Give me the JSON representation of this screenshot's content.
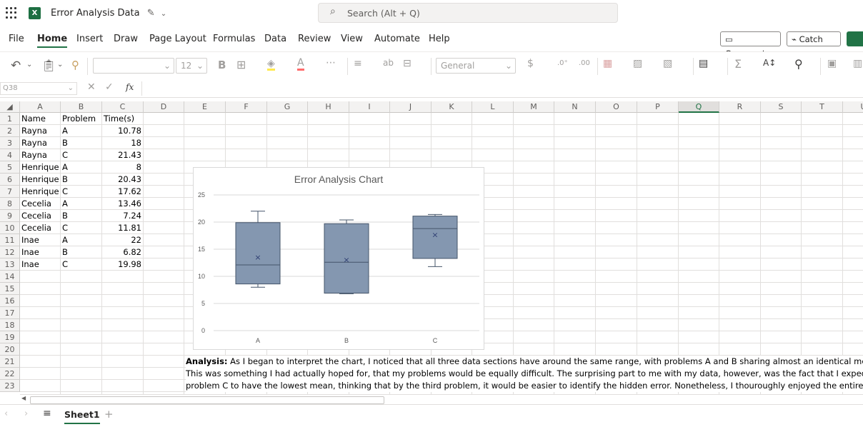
{
  "titlebar": {
    "doc_title": "Error Analysis Data",
    "app_icon_letter": "X",
    "search_placeholder": "Search (Alt + Q)"
  },
  "menu": {
    "items": [
      "File",
      "Home",
      "Insert",
      "Draw",
      "Page Layout",
      "Formulas",
      "Data",
      "Review",
      "View",
      "Automate",
      "Help"
    ],
    "active": "Home",
    "comments_label": "Comments",
    "catchup_label": "Catch up"
  },
  "ribbon": {
    "font_size": "12",
    "number_format": "General"
  },
  "formula_bar": {
    "name_box": "Q38",
    "fx_label": "fx"
  },
  "sheet": {
    "columns": [
      "A",
      "B",
      "C",
      "D",
      "E",
      "F",
      "G",
      "H",
      "I",
      "J",
      "K",
      "L",
      "M",
      "N",
      "O",
      "P",
      "Q",
      "R",
      "S",
      "T",
      "U"
    ],
    "selected_column": "Q",
    "row_numbers": [
      "1",
      "2",
      "3",
      "4",
      "5",
      "6",
      "7",
      "8",
      "9",
      "10",
      "11",
      "12",
      "13",
      "14",
      "15",
      "16",
      "17",
      "18",
      "19",
      "20",
      "21",
      "22",
      "23"
    ],
    "headers": [
      "Name",
      "Problem",
      "Time(s)"
    ],
    "rows": [
      [
        "Rayna",
        "A",
        "10.78"
      ],
      [
        "Rayna",
        "B",
        "18"
      ],
      [
        "Rayna",
        "C",
        "21.43"
      ],
      [
        "Henrique",
        "A",
        "8"
      ],
      [
        "Henrique",
        "B",
        "20.43"
      ],
      [
        "Henrique",
        "C",
        "17.62"
      ],
      [
        "Cecelia",
        "A",
        "13.46"
      ],
      [
        "Cecelia",
        "B",
        "7.24"
      ],
      [
        "Cecelia",
        "C",
        "11.81"
      ],
      [
        "Inae",
        "A",
        "22"
      ],
      [
        "Inae",
        "B",
        "6.82"
      ],
      [
        "Inae",
        "C",
        "19.98"
      ]
    ],
    "analysis_label": "Analysis:",
    "analysis_lines": [
      " As I began to interpret the chart, I noticed that all three data sections have around the same range, with problems A and B sharing almost an identical mean.",
      "This was something I had actually hoped for, that my problems would be equally difficult. The surprising part to me with my data, however, was the fact that I expected",
      "problem C to have the lowest mean, thinking that by the third problem, it would be easier to identify the hidden error. Nonetheless, I thouroughly enjoyed the entire process,"
    ]
  },
  "chart_data": {
    "type": "box",
    "title": "Error Analysis Chart",
    "categories": [
      "A",
      "B",
      "C"
    ],
    "ylim": [
      0,
      25
    ],
    "yticks": [
      "0",
      "5",
      "10",
      "15",
      "20",
      "25"
    ],
    "grid": true,
    "boxes": [
      {
        "category": "A",
        "min": 8,
        "q1": 8.6,
        "median": 12.1,
        "q3": 19.9,
        "max": 22,
        "mean": 13.56
      },
      {
        "category": "B",
        "min": 6.8,
        "q1": 6.9,
        "median": 12.6,
        "q3": 19.7,
        "max": 20.4,
        "mean": 13.12
      },
      {
        "category": "C",
        "min": 11.8,
        "q1": 13.3,
        "median": 18.8,
        "q3": 21.1,
        "max": 21.4,
        "mean": 17.71
      }
    ],
    "box_color": "#8497b0",
    "box_stroke": "#44546a"
  },
  "sheet_tabs": {
    "active": "Sheet1"
  }
}
